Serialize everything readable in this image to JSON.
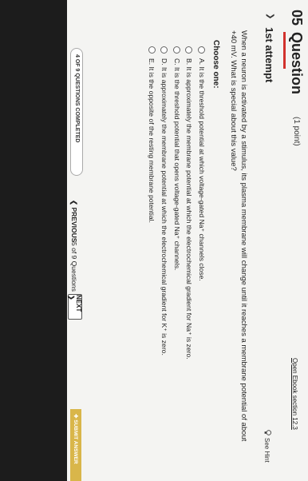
{
  "header": {
    "number": "05",
    "title": "Question",
    "points": "(1 point)",
    "ebook_link": "Open Ebook section 12.3"
  },
  "attempt": {
    "label": "1st attempt",
    "hint": "See Hint"
  },
  "question": {
    "text": "When a neuron is activated by a stimulus, its plasma membrane will change until it reaches a membrane potential of about +40 mV. What is special about this value?"
  },
  "choose_label": "Choose one:",
  "options": [
    {
      "text": "A. It is the threshold potential at which voltage-gated Na⁺ channels close."
    },
    {
      "text": "B. It is approximately the membrane potential at which the electrochemical gradient for Na⁺ is zero."
    },
    {
      "text": "C. It is the threshold potential that opens voltage-gated Na⁺ channels."
    },
    {
      "text": "D. It is approximately the membrane potential at which the electrochemical gradient for K⁺ is zero."
    },
    {
      "text": "E. It is the opposite of the resting membrane potential."
    }
  ],
  "footer": {
    "progress": "4 OF 9 QUESTIONS COMPLETED",
    "progress_fraction": 0.444,
    "prev": "❮ PREVIOUS",
    "count": "5 of 9 Questions",
    "next": "NEXT ❯",
    "submit": "✚ SUBMIT ANSWER"
  }
}
